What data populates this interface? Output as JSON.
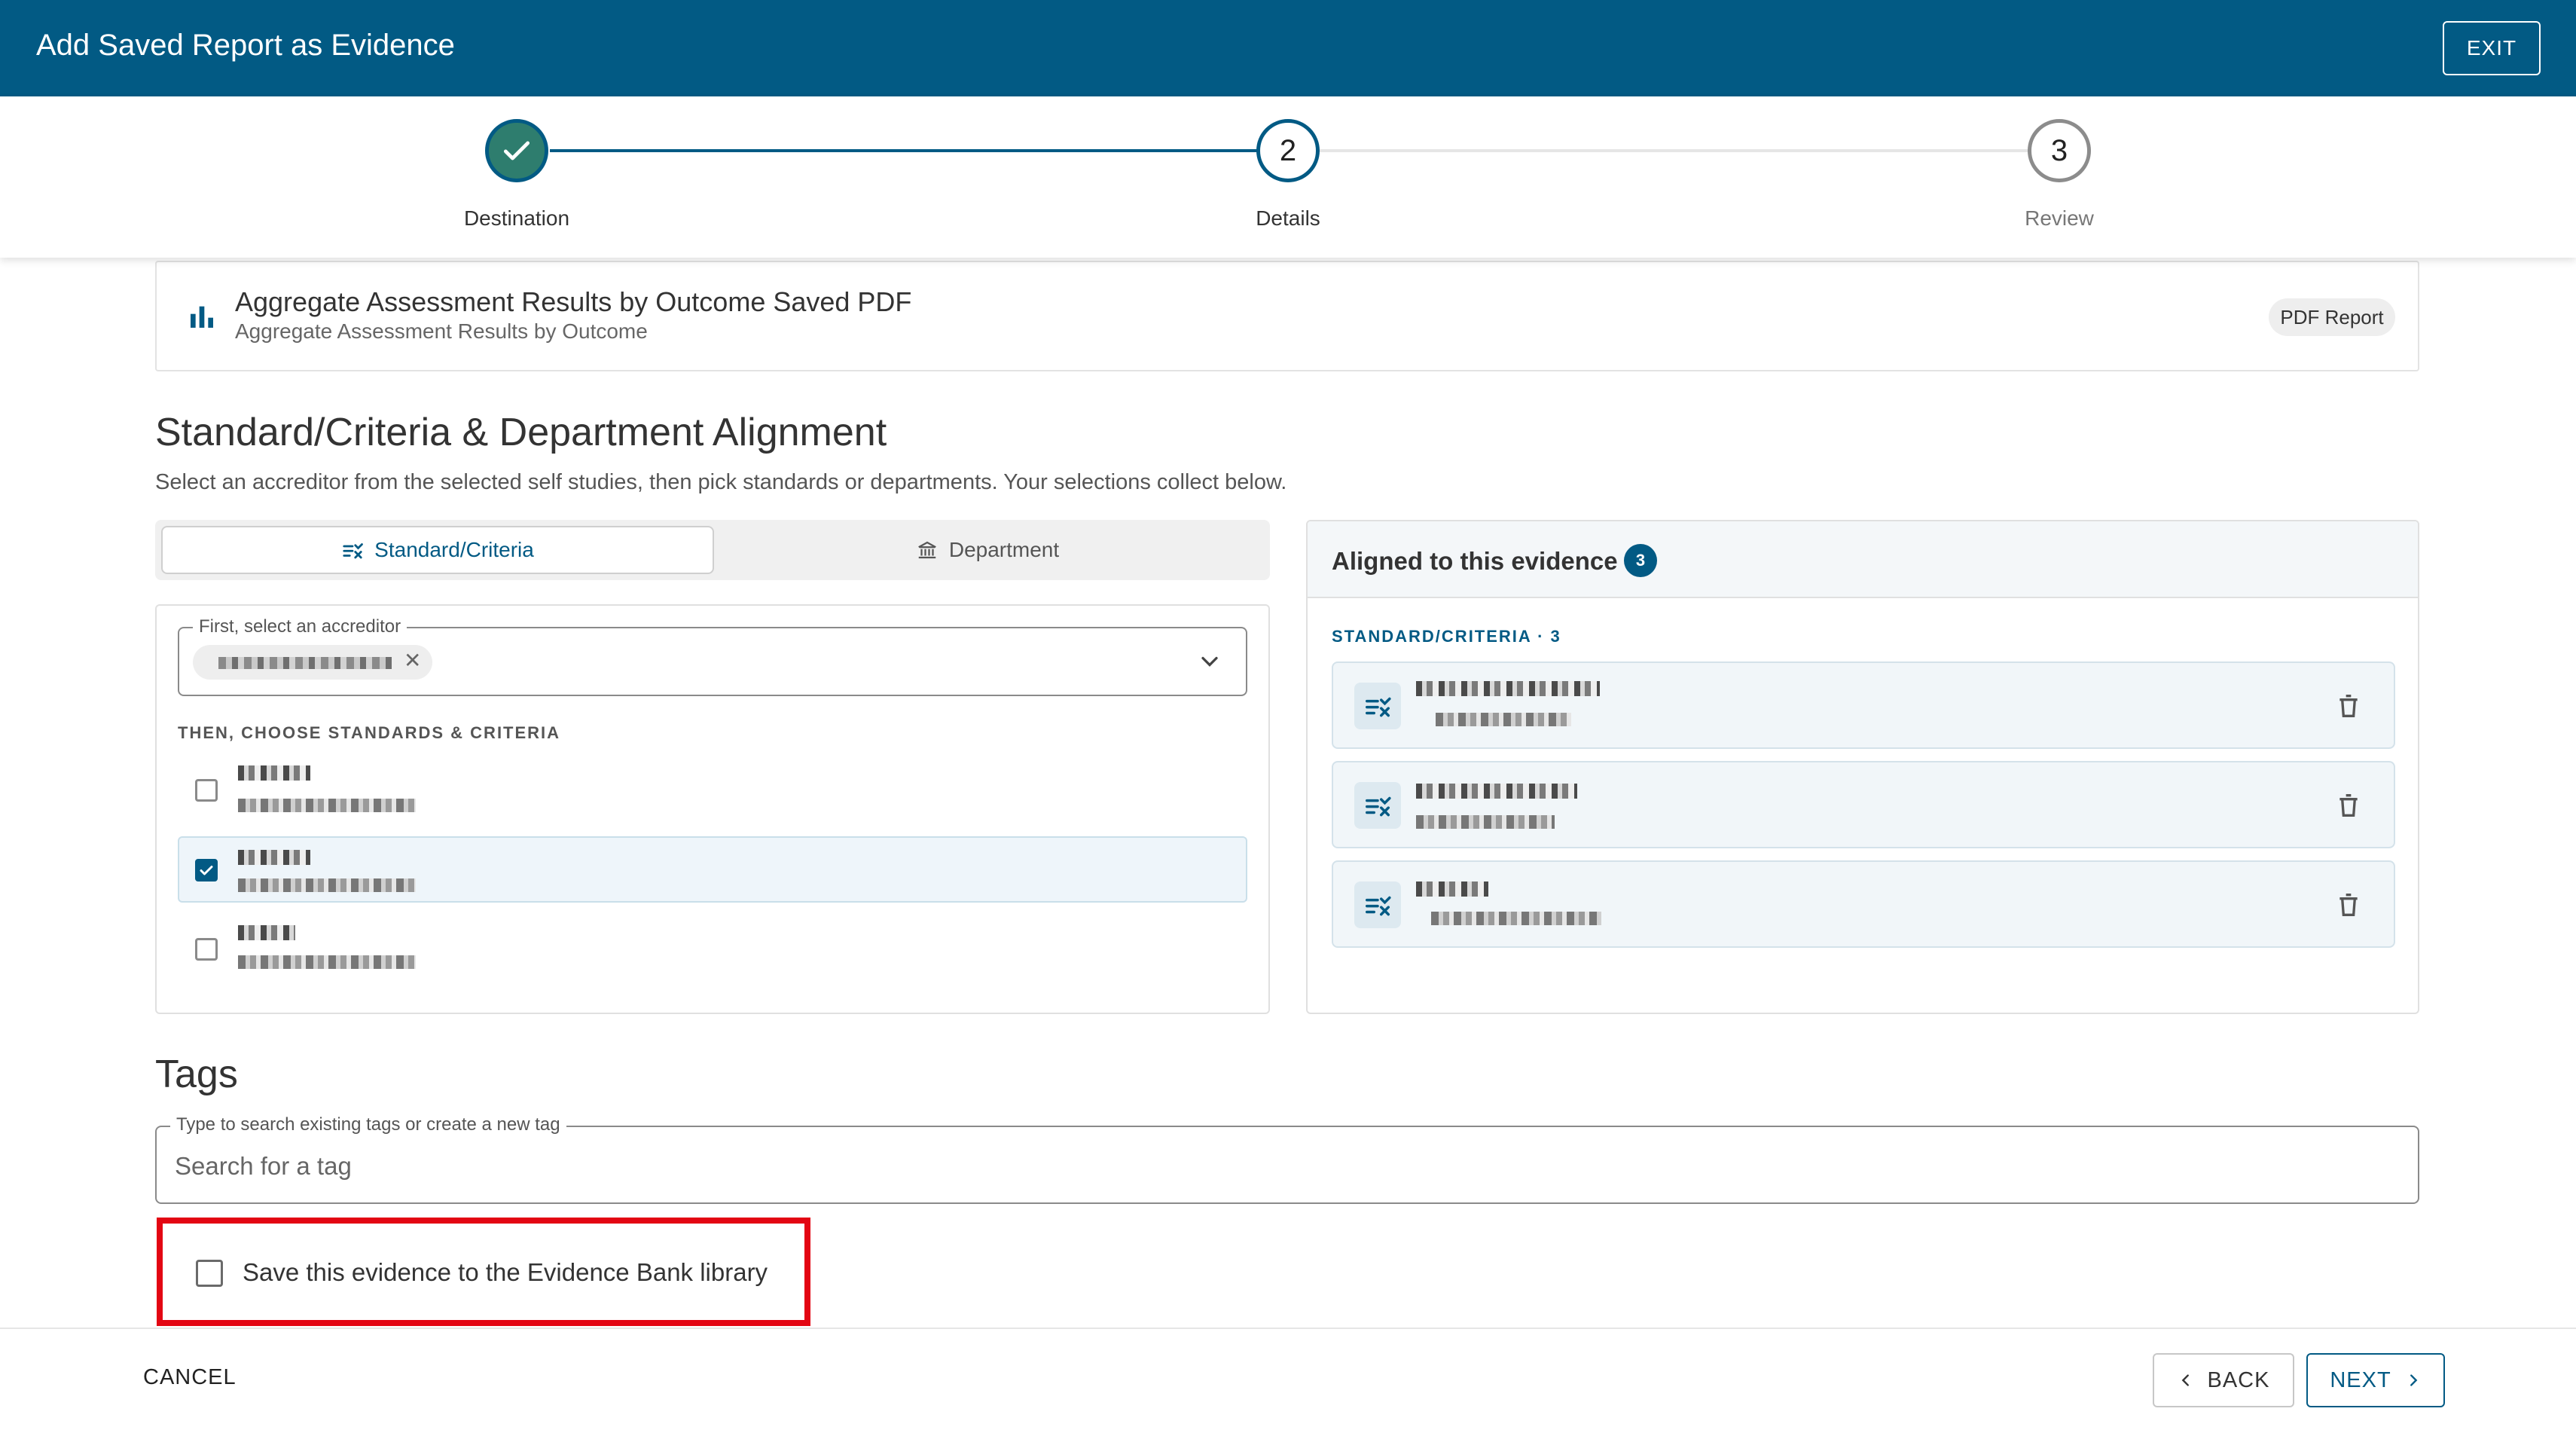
{
  "header": {
    "title": "Add Saved Report as Evidence",
    "exit_label": "EXIT"
  },
  "stepper": {
    "steps": [
      {
        "label": "Destination",
        "number": "",
        "state": "complete"
      },
      {
        "label": "Details",
        "number": "2",
        "state": "active"
      },
      {
        "label": "Review",
        "number": "3",
        "state": "upcoming"
      }
    ]
  },
  "report": {
    "title": "Aggregate Assessment Results by Outcome Saved PDF",
    "subtitle": "Aggregate Assessment Results by Outcome",
    "badge": "PDF Report",
    "icon": "bar-chart-icon"
  },
  "alignment": {
    "heading": "Standard/Criteria & Department Alignment",
    "description": "Select an accreditor from the selected self studies, then pick standards or departments. Your selections collect below.",
    "tabs": [
      {
        "label": "Standard/Criteria",
        "icon": "standards-icon",
        "active": true
      },
      {
        "label": "Department",
        "icon": "bank-icon",
        "active": false
      }
    ],
    "accreditor_label": "First, select an accreditor",
    "choose_label": "THEN, CHOOSE STANDARDS & CRITERIA",
    "standards": [
      {
        "checked": false
      },
      {
        "checked": true
      },
      {
        "checked": false
      }
    ]
  },
  "aligned": {
    "title": "Aligned to this evidence",
    "count": "3",
    "section_label": "STANDARD/CRITERIA · 3",
    "items": [
      {},
      {},
      {}
    ]
  },
  "tags": {
    "heading": "Tags",
    "field_label": "Type to search existing tags or create a new tag",
    "placeholder": "Search for a tag"
  },
  "save_option": {
    "label": "Save this evidence to the Evidence Bank library",
    "checked": false
  },
  "footer": {
    "cancel_label": "CANCEL",
    "back_label": "BACK",
    "next_label": "NEXT"
  },
  "colors": {
    "primary": "#025a84",
    "complete": "#2e7d6e",
    "highlight": "#e30613"
  }
}
